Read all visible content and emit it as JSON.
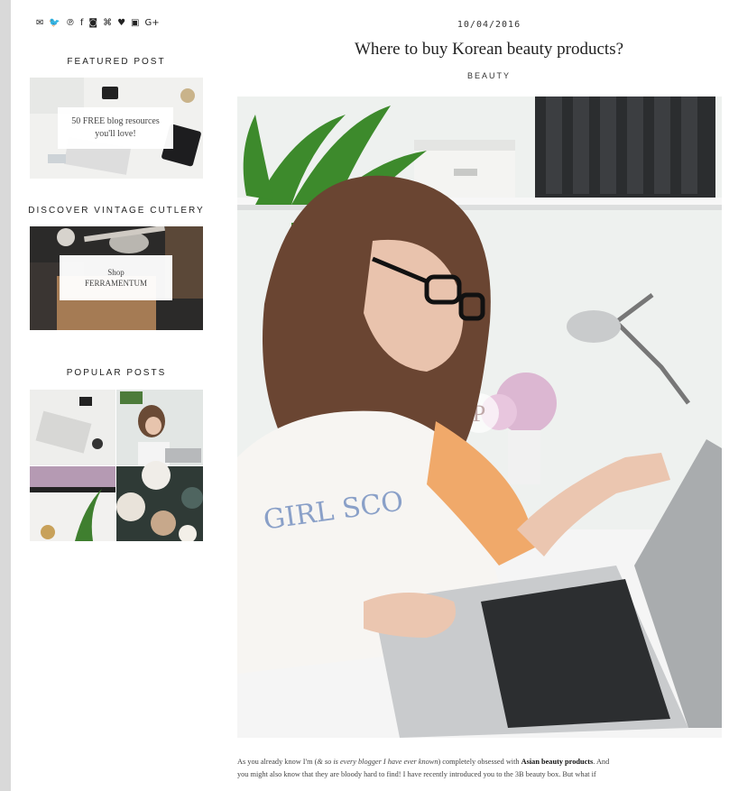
{
  "social": {
    "icons": [
      "mail-icon",
      "twitter-icon",
      "pinterest-icon",
      "facebook-icon",
      "instagram-icon",
      "rss-icon",
      "heart-icon",
      "youtube-icon",
      "google-plus-icon"
    ],
    "glyphs": [
      "✉",
      "🐦",
      "℗",
      "f",
      "◙",
      "⌘",
      "♥",
      "▣",
      "G+"
    ]
  },
  "sidebar": {
    "featured_title": "FEATURED POST",
    "featured_card": "50 FREE blog resources you'll love!",
    "vintage_title": "DISCOVER VINTAGE CUTLERY",
    "vintage_card_line1": "Shop",
    "vintage_card_line2": "FERRAMENTUM",
    "popular_title": "POPULAR POSTS"
  },
  "post": {
    "date": "10/04/2016",
    "title": "Where to buy Korean beauty products?",
    "category": "BEAUTY",
    "excerpt_line1_a": "As you already know I'm (",
    "excerpt_line1_italic": "& so is every blogger I have ever known",
    "excerpt_line1_b": ") completely obsessed with ",
    "excerpt_line1_bold": "Asian beauty products",
    "excerpt_line1_c": ". And",
    "excerpt_line2": "you might also know that they are bloody hard to find! I have recently introduced you to the 3B beauty box. But what if"
  },
  "colors": {
    "background": "#d9d9d9",
    "page": "#ffffff",
    "text": "#222222"
  }
}
